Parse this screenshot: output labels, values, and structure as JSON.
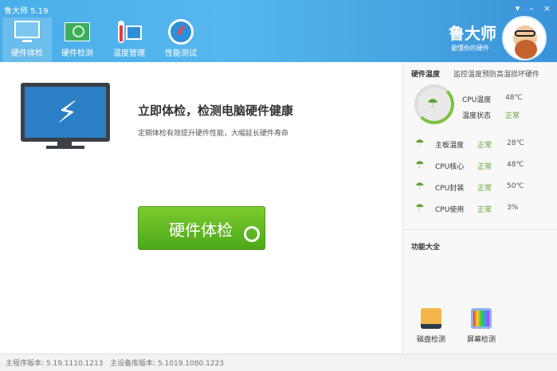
{
  "app": {
    "title": "鲁大师 5.19",
    "brand": "鲁大师",
    "slogan": "最懂你的硬件"
  },
  "window_controls": {
    "menu": "▾",
    "minimize": "–",
    "close": "×"
  },
  "tabs": [
    {
      "label": "硬件体检"
    },
    {
      "label": "硬件检测"
    },
    {
      "label": "温度管理"
    },
    {
      "label": "性能测试"
    }
  ],
  "main": {
    "headline": "立即体检，检测电脑硬件健康",
    "subtitle": "定期体检有效提升硬件性能，大幅延长硬件寿命",
    "check_button": "硬件体检"
  },
  "temperature": {
    "title": "硬件温度",
    "subtitle": "监控温度预防高温损坏硬件",
    "cpu_temp_label": "CPU温度",
    "cpu_temp_value": "48℃",
    "status_label": "温度状态",
    "status_value": "正常",
    "gauge_fraction": 0.5,
    "rows": [
      {
        "name": "主板温度",
        "status": "正常",
        "value": "28℃"
      },
      {
        "name": "CPU核心",
        "status": "正常",
        "value": "48℃"
      },
      {
        "name": "CPU封装",
        "status": "正常",
        "value": "50℃"
      },
      {
        "name": "CPU使用",
        "status": "正常",
        "value": "3%"
      }
    ]
  },
  "functions": {
    "title": "功能大全",
    "items": [
      {
        "label": "磁盘检测"
      },
      {
        "label": "屏幕检测"
      }
    ]
  },
  "footer": {
    "main_version": "主程序版本: 5.19.1110.1213",
    "db_version": "主设备库版本: 5.1019.1080.1223"
  },
  "colors": {
    "header": "#4aaee9",
    "accent_green": "#5aa52a"
  }
}
